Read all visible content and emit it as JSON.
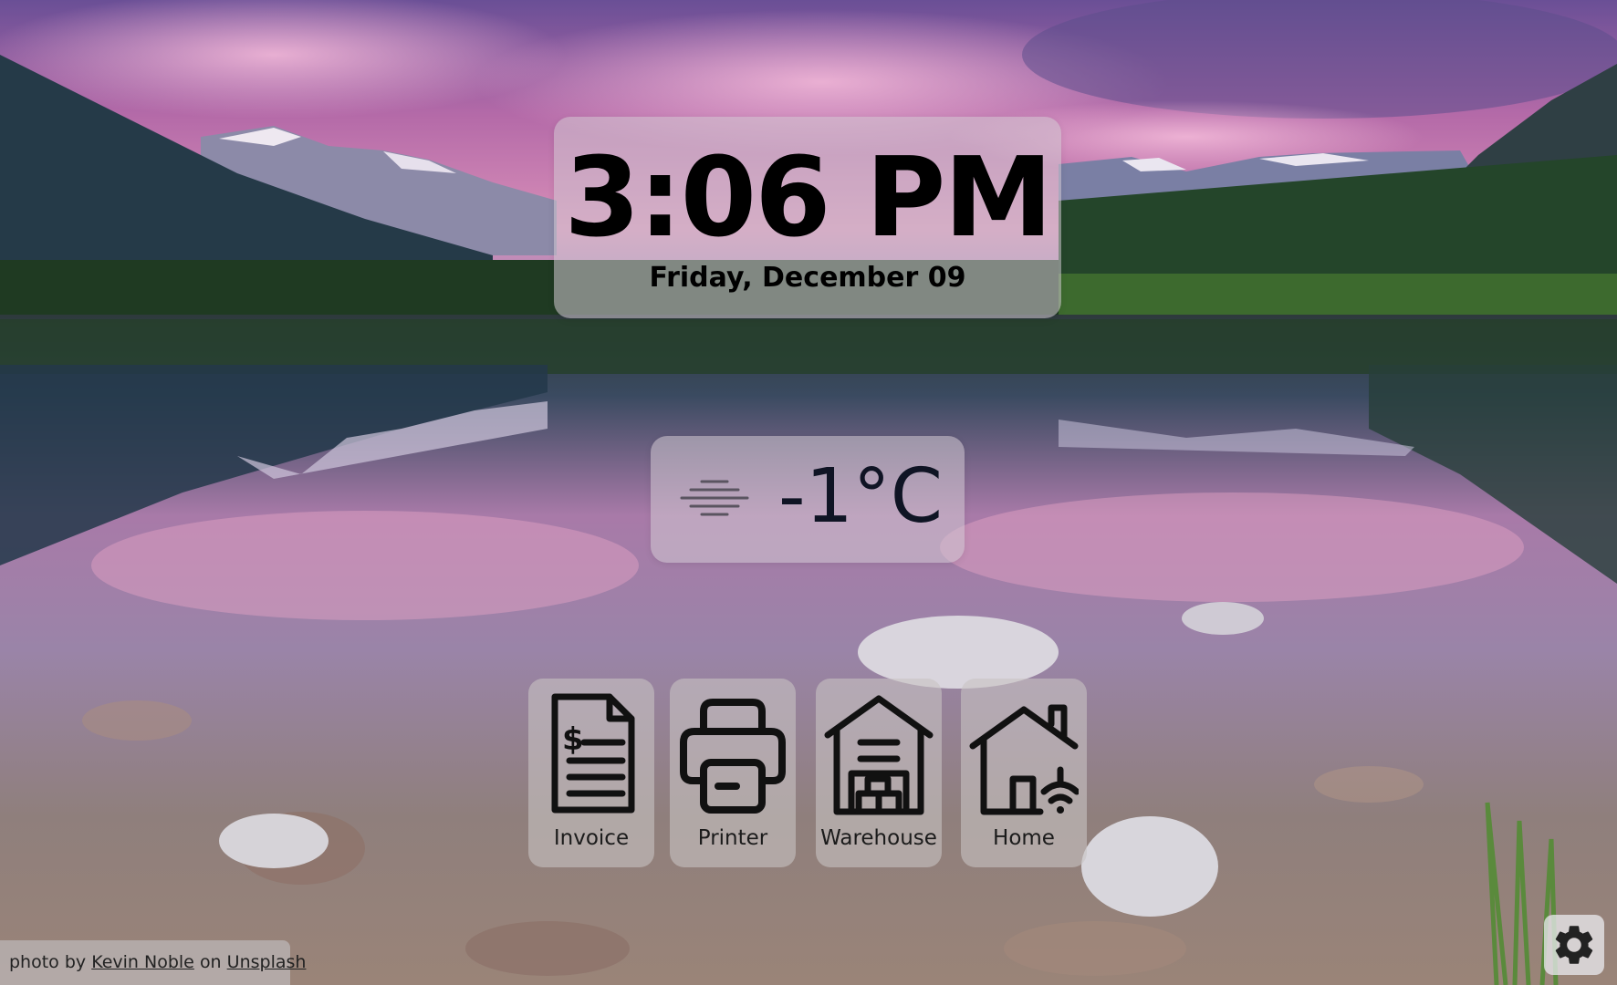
{
  "clock": {
    "time": "3:06 PM",
    "date": "Friday, December 09"
  },
  "weather": {
    "temperature": "-1°C",
    "condition_icon": "fog-icon"
  },
  "shortcuts": [
    {
      "label": "Invoice",
      "icon": "invoice-icon"
    },
    {
      "label": "Printer",
      "icon": "printer-icon"
    },
    {
      "label": "Warehouse",
      "icon": "warehouse-icon"
    },
    {
      "label": "Home",
      "icon": "smart-home-icon"
    }
  ],
  "credit": {
    "prefix": "photo by",
    "author": "Kevin Noble",
    "middle": "on",
    "site": "Unsplash"
  },
  "settings": {
    "icon": "gear-icon"
  },
  "colors": {
    "text_dark": "#000000",
    "temp_text": "#0f1424",
    "card_glass": "#d2c8d2"
  }
}
